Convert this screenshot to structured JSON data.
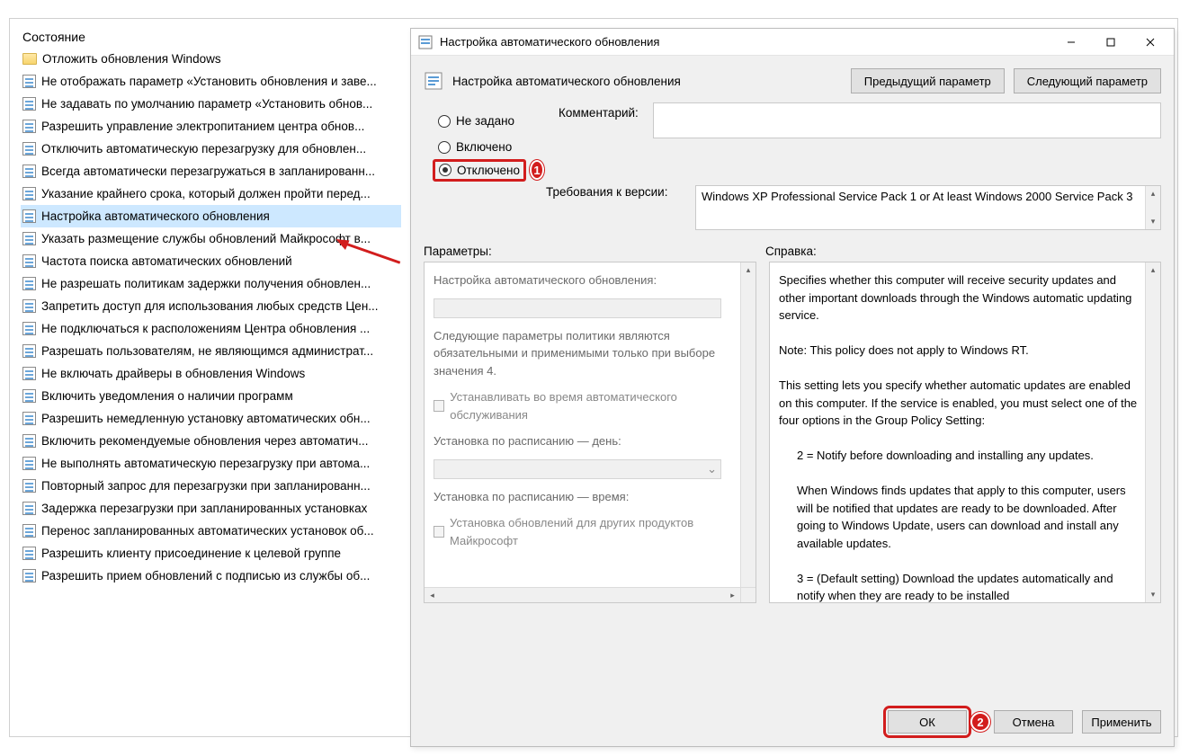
{
  "leftPane": {
    "header": "Состояние",
    "folderItem": "Отложить обновления Windows",
    "items": [
      "Не отображать параметр «Установить обновления и заве...",
      "Не задавать по умолчанию параметр «Установить обнов...",
      "Разрешить управление электропитанием центра обнов...",
      "Отключить автоматическую перезагрузку для обновлен...",
      "Всегда автоматически перезагружаться в запланированн...",
      "Указание крайнего срока, который должен пройти перед...",
      "Настройка автоматического обновления",
      "Указать размещение службы обновлений Майкрософт в...",
      "Частота поиска автоматических обновлений",
      "Не разрешать политикам задержки получения обновлен...",
      "Запретить доступ для использования любых средств Цен...",
      "Не подключаться к расположениям Центра обновления ...",
      "Разрешать пользователям, не являющимся администрат...",
      "Не включать драйверы в обновления Windows",
      "Включить уведомления о наличии программ",
      "Разрешить немедленную установку автоматических обн...",
      "Включить рекомендуемые обновления через автоматич...",
      "Не выполнять автоматическую перезагрузку при автома...",
      "Повторный запрос для перезагрузки при запланированн...",
      "Задержка перезагрузки при запланированных установках",
      "Перенос запланированных автоматических установок об...",
      "Разрешить клиенту присоединение к целевой группе",
      "Разрешить прием обновлений с подписью из службы об..."
    ],
    "selectedIndex": 6
  },
  "dialog": {
    "title": "Настройка автоматического обновления",
    "headerName": "Настройка автоматического обновления",
    "prevButton": "Предыдущий параметр",
    "nextButton": "Следующий параметр",
    "radios": {
      "notConfigured": "Не задано",
      "enabled": "Включено",
      "disabled": "Отключено",
      "selected": "disabled"
    },
    "commentLabel": "Комментарий:",
    "commentValue": "",
    "requirementsLabel": "Требования к версии:",
    "requirementsValue": "Windows XP Professional Service Pack 1 or At least Windows 2000 Service Pack 3",
    "paramsLabel": "Параметры:",
    "helpLabel": "Справка:",
    "params": {
      "title": "Настройка автоматического обновления:",
      "note": "Следующие параметры политики являются обязательными и применимыми только при выборе значения 4.",
      "chkMaintenance": "Устанавливать во время автоматического обслуживания",
      "dayLabel": "Установка по расписанию — день:",
      "timeLabel": "Установка по расписанию — время:",
      "chkOther": "Установка обновлений для других продуктов Майкрософт"
    },
    "help": {
      "p1": "Specifies whether this computer will receive security updates and other important downloads through the Windows automatic updating service.",
      "p2": "Note: This policy does not apply to Windows RT.",
      "p3": "This setting lets you specify whether automatic updates are enabled on this computer. If the service is enabled, you must select one of the four options in the Group Policy Setting:",
      "opt2": "2 = Notify before downloading and installing any updates.",
      "opt2b": "When Windows finds updates that apply to this computer, users will be notified that updates are ready to be downloaded. After going to Windows Update, users can download and install any available updates.",
      "opt3": "3 = (Default setting) Download the updates automatically and notify when they are ready to be installed"
    },
    "buttons": {
      "ok": "ОК",
      "cancel": "Отмена",
      "apply": "Применить"
    }
  },
  "callouts": {
    "one": "1",
    "two": "2"
  }
}
